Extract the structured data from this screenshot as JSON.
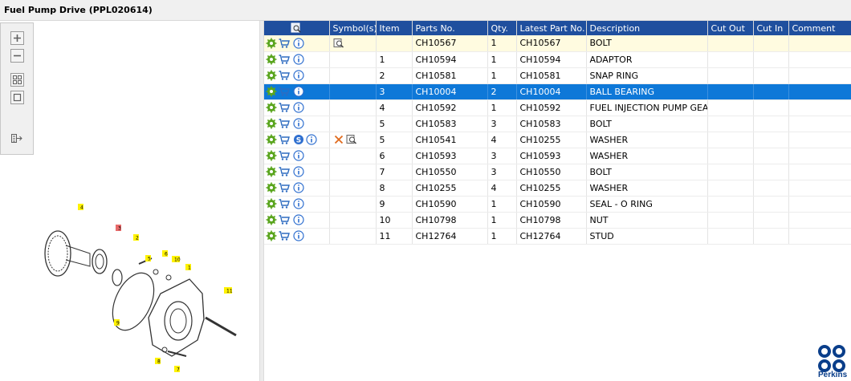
{
  "window": {
    "title": "Fuel Pump Drive (PPL020614)"
  },
  "viewer": {
    "tools": [
      {
        "name": "zoom-in-button"
      },
      {
        "name": "zoom-out-button"
      },
      {
        "name": "fit-all-button"
      },
      {
        "name": "fit-window-button"
      },
      {
        "name": "export-button"
      }
    ],
    "callouts": [
      "4",
      "3",
      "2",
      "5",
      "6",
      "10",
      "1",
      "11",
      "9",
      "8",
      "7"
    ]
  },
  "grid": {
    "columns": [
      "",
      "Symbol(s)",
      "Item",
      "Parts No.",
      "Qty.",
      "Latest Part No.",
      "Description",
      "Cut Out",
      "Cut In",
      "Comment"
    ],
    "rows": [
      {
        "item": "",
        "part": "CH10567",
        "qty": "1",
        "latest": "CH10567",
        "desc": "BOLT",
        "cut_out": "",
        "cut_in": "",
        "comment": ""
      },
      {
        "item": "1",
        "part": "CH10594",
        "qty": "1",
        "latest": "CH10594",
        "desc": "ADAPTOR",
        "cut_out": "",
        "cut_in": "",
        "comment": ""
      },
      {
        "item": "2",
        "part": "CH10581",
        "qty": "1",
        "latest": "CH10581",
        "desc": "SNAP RING",
        "cut_out": "",
        "cut_in": "",
        "comment": ""
      },
      {
        "item": "3",
        "part": "CH10004",
        "qty": "2",
        "latest": "CH10004",
        "desc": "BALL BEARING",
        "cut_out": "",
        "cut_in": "",
        "comment": ""
      },
      {
        "item": "4",
        "part": "CH10592",
        "qty": "1",
        "latest": "CH10592",
        "desc": "FUEL INJECTION PUMP GEAR",
        "cut_out": "",
        "cut_in": "",
        "comment": ""
      },
      {
        "item": "5",
        "part": "CH10583",
        "qty": "3",
        "latest": "CH10583",
        "desc": "BOLT",
        "cut_out": "",
        "cut_in": "",
        "comment": ""
      },
      {
        "item": "5",
        "part": "CH10541",
        "qty": "4",
        "latest": "CH10255",
        "desc": "WASHER",
        "cut_out": "",
        "cut_in": "",
        "comment": ""
      },
      {
        "item": "6",
        "part": "CH10593",
        "qty": "3",
        "latest": "CH10593",
        "desc": "WASHER",
        "cut_out": "",
        "cut_in": "",
        "comment": ""
      },
      {
        "item": "7",
        "part": "CH10550",
        "qty": "3",
        "latest": "CH10550",
        "desc": "BOLT",
        "cut_out": "",
        "cut_in": "",
        "comment": ""
      },
      {
        "item": "8",
        "part": "CH10255",
        "qty": "4",
        "latest": "CH10255",
        "desc": "WASHER",
        "cut_out": "",
        "cut_in": "",
        "comment": ""
      },
      {
        "item": "9",
        "part": "CH10590",
        "qty": "1",
        "latest": "CH10590",
        "desc": "SEAL - O RING",
        "cut_out": "",
        "cut_in": "",
        "comment": ""
      },
      {
        "item": "10",
        "part": "CH10798",
        "qty": "1",
        "latest": "CH10798",
        "desc": "NUT",
        "cut_out": "",
        "cut_in": "",
        "comment": ""
      },
      {
        "item": "11",
        "part": "CH12764",
        "qty": "1",
        "latest": "CH12764",
        "desc": "STUD",
        "cut_out": "",
        "cut_in": "",
        "comment": ""
      }
    ],
    "selected_row_index": 3
  },
  "brand": {
    "name": "Perkins",
    "color": "#0a3e8a"
  },
  "colors": {
    "header_bg": "#1f4f9e",
    "selected_bg": "#0e78d8",
    "highlight_bg": "#fffbe0",
    "gear_green": "#5aa51e",
    "cart_blue": "#2e6cc0",
    "info_blue": "#2f6fcf"
  },
  "icons": {
    "header": "view-drawing-icon",
    "row_actions": [
      "settings-gear-icon",
      "shopping-cart-icon",
      "info-icon"
    ],
    "row_symbols": [
      "drawing-link-icon",
      "supersession-s-icon",
      "remove-x-icon"
    ]
  }
}
